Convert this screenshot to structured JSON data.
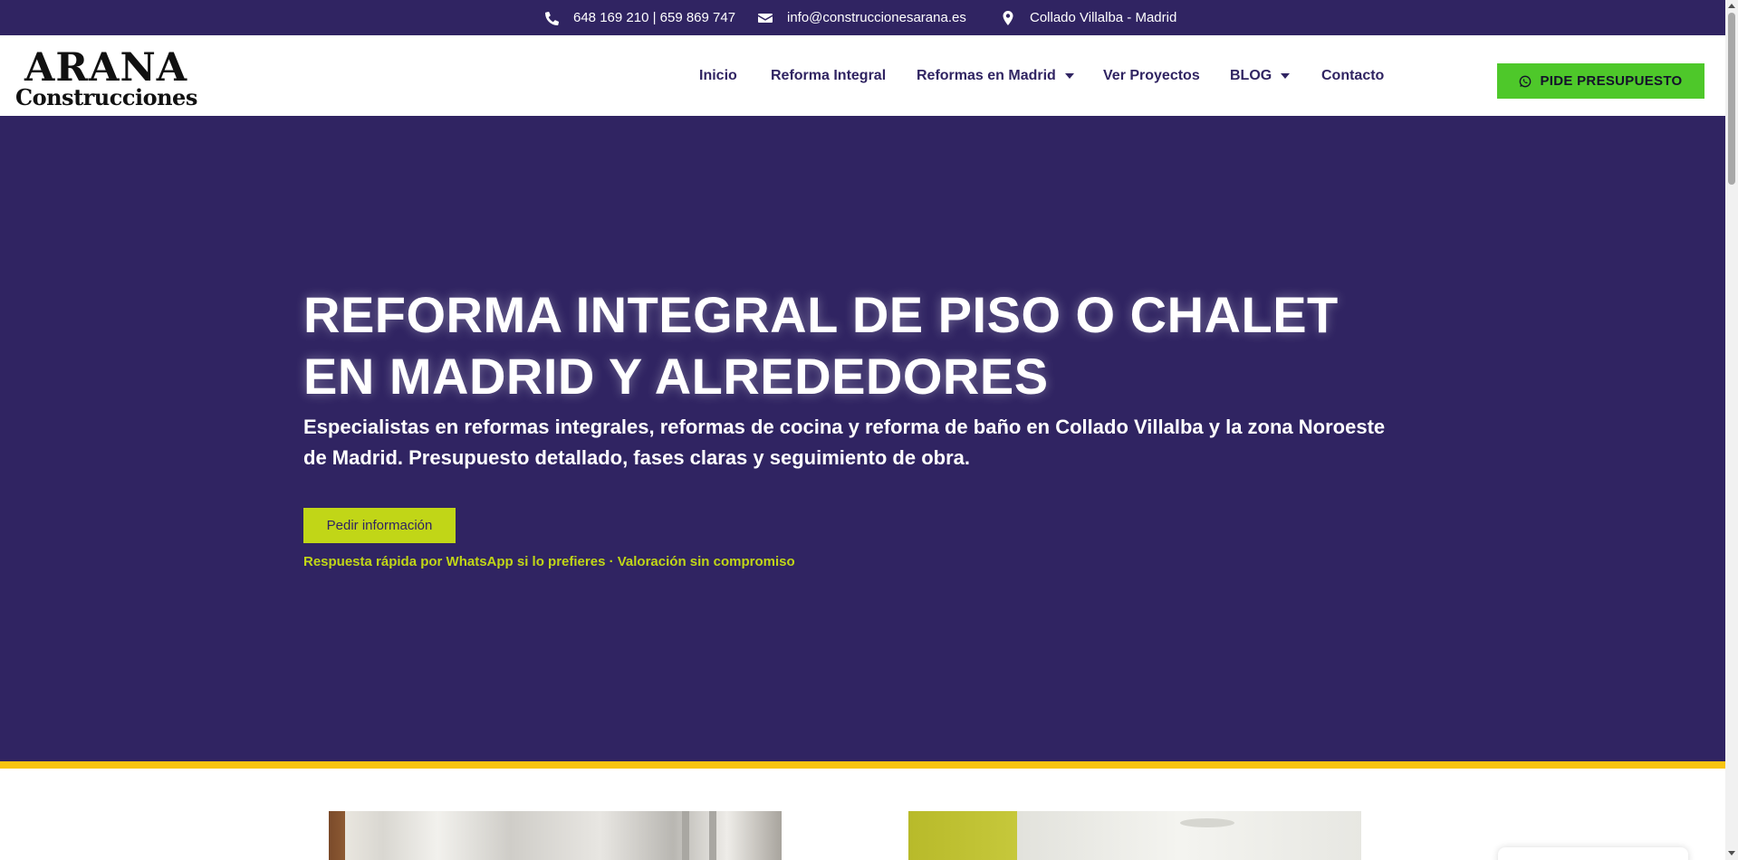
{
  "topbar": {
    "phone": "648 169 210 | 659 869 747",
    "email": "info@construccionesarana.es",
    "location": "Collado Villalba - Madrid",
    "phone_icon": "phone-icon",
    "email_icon": "envelope-icon",
    "location_icon": "map-marker-icon"
  },
  "logo": {
    "line1": "ARANA",
    "line2": "Construcciones"
  },
  "nav": {
    "items": [
      {
        "label": "Inicio"
      },
      {
        "label": "Reforma Integral"
      },
      {
        "label": "Reformas en Madrid",
        "has_dropdown": true
      },
      {
        "label": "Ver Proyectos"
      },
      {
        "label": "BLOG",
        "has_dropdown": true
      },
      {
        "label": "Contacto"
      }
    ]
  },
  "cta": {
    "label": "PIDE PRESUPUESTO",
    "icon": "whatsapp-icon",
    "color": "#4ec82a"
  },
  "hero": {
    "title": "REFORMA INTEGRAL DE PISO O CHALET EN MADRID Y ALREDEDORES",
    "subtitle": "Especialistas en reformas integrales, reformas de cocina y reforma de baño en Collado Villalba y la zona Noroeste de Madrid. Presupuesto detallado, fases claras y seguimiento de obra.",
    "button_label": "Pedir información",
    "note": "Respuesta rápida por WhatsApp si lo prefieres · Valoración sin compromiso",
    "background_color": "#302462",
    "accent_color": "#c1d617",
    "stripe_color": "#f8c411"
  }
}
